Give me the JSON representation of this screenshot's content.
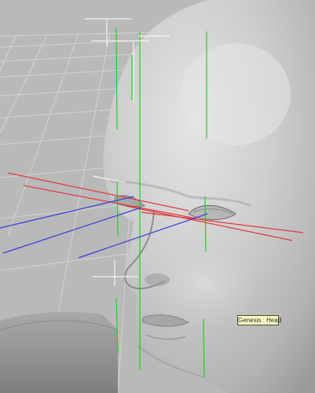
{
  "viewport": {
    "background": "#b9b9b9",
    "grid_color": "#cfcfcf",
    "figure_color": "#c4c4c4",
    "guide_colors": {
      "green": "#1fd31f",
      "red": "#e23a3a",
      "blue": "#3b3bde",
      "white": "#f2f2f2"
    }
  },
  "tooltip": {
    "text": "Genesis : Head"
  }
}
